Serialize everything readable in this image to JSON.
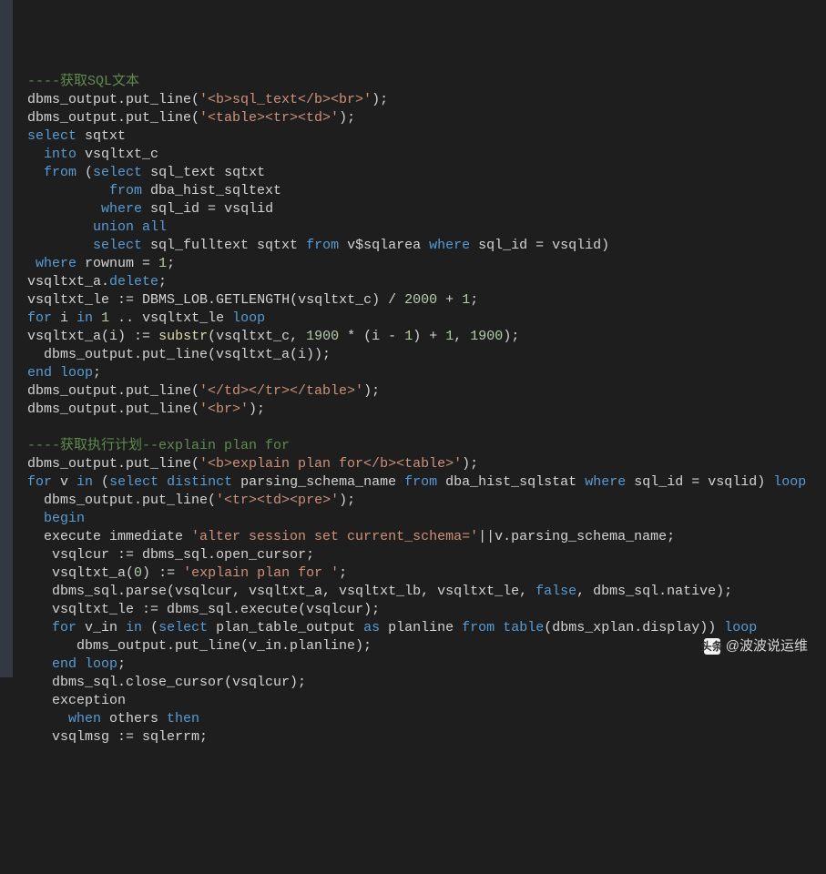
{
  "colors": {
    "bg": "#1e1e1e",
    "gutter": "#333842",
    "text": "#d4d4d4",
    "keyword": "#569cd6",
    "keyword2": "#c586c0",
    "string": "#ce9178",
    "number": "#b5cea8",
    "comment": "#608b4e",
    "function": "#dcdcaa",
    "teal": "#4ec9b0"
  },
  "code": [
    [
      [
        "c-com",
        "----获取SQL文本"
      ]
    ],
    [
      [
        "c-plain",
        "dbms_output.put_line("
      ],
      [
        "c-str",
        "'<b>sql_text</b><br>'"
      ],
      [
        "c-plain",
        ");"
      ]
    ],
    [
      [
        "c-plain",
        "dbms_output.put_line("
      ],
      [
        "c-str",
        "'<table><tr><td>'"
      ],
      [
        "c-plain",
        ");"
      ]
    ],
    [
      [
        "c-kw",
        "select"
      ],
      [
        "c-plain",
        " sqtxt"
      ]
    ],
    [
      [
        "c-plain",
        "  "
      ],
      [
        "c-kw",
        "into"
      ],
      [
        "c-plain",
        " vsqltxt_c"
      ]
    ],
    [
      [
        "c-plain",
        "  "
      ],
      [
        "c-kw",
        "from"
      ],
      [
        "c-plain",
        " ("
      ],
      [
        "c-kw",
        "select"
      ],
      [
        "c-plain",
        " sql_text sqtxt"
      ]
    ],
    [
      [
        "c-plain",
        "          "
      ],
      [
        "c-kw",
        "from"
      ],
      [
        "c-plain",
        " dba_hist_sqltext"
      ]
    ],
    [
      [
        "c-plain",
        "         "
      ],
      [
        "c-kw",
        "where"
      ],
      [
        "c-plain",
        " sql_id "
      ],
      [
        "c-op",
        "="
      ],
      [
        "c-plain",
        " vsqlid"
      ]
    ],
    [
      [
        "c-plain",
        "        "
      ],
      [
        "c-kw",
        "union all"
      ]
    ],
    [
      [
        "c-plain",
        "        "
      ],
      [
        "c-kw",
        "select"
      ],
      [
        "c-plain",
        " sql_fulltext sqtxt "
      ],
      [
        "c-kw",
        "from"
      ],
      [
        "c-plain",
        " v$sqlarea "
      ],
      [
        "c-kw",
        "where"
      ],
      [
        "c-plain",
        " sql_id "
      ],
      [
        "c-op",
        "="
      ],
      [
        "c-plain",
        " vsqlid)"
      ]
    ],
    [
      [
        "c-plain",
        " "
      ],
      [
        "c-kw",
        "where"
      ],
      [
        "c-plain",
        " rownum "
      ],
      [
        "c-op",
        "="
      ],
      [
        "c-plain",
        " "
      ],
      [
        "c-num",
        "1"
      ],
      [
        "c-plain",
        ";"
      ]
    ],
    [
      [
        "c-plain",
        "vsqltxt_a."
      ],
      [
        "c-kw",
        "delete"
      ],
      [
        "c-plain",
        ";"
      ]
    ],
    [
      [
        "c-plain",
        "vsqltxt_le "
      ],
      [
        "c-op",
        ":="
      ],
      [
        "c-plain",
        " DBMS_LOB.GETLENGTH(vsqltxt_c) "
      ],
      [
        "c-op",
        "/"
      ],
      [
        "c-plain",
        " "
      ],
      [
        "c-num",
        "2000"
      ],
      [
        "c-plain",
        " "
      ],
      [
        "c-op",
        "+"
      ],
      [
        "c-plain",
        " "
      ],
      [
        "c-num",
        "1"
      ],
      [
        "c-plain",
        ";"
      ]
    ],
    [
      [
        "c-kw",
        "for"
      ],
      [
        "c-plain",
        " i "
      ],
      [
        "c-kw",
        "in"
      ],
      [
        "c-plain",
        " "
      ],
      [
        "c-num",
        "1"
      ],
      [
        "c-plain",
        " .. vsqltxt_le "
      ],
      [
        "c-kw",
        "loop"
      ]
    ],
    [
      [
        "c-plain",
        "vsqltxt_a(i) "
      ],
      [
        "c-op",
        ":="
      ],
      [
        "c-plain",
        " "
      ],
      [
        "c-fn",
        "substr"
      ],
      [
        "c-plain",
        "(vsqltxt_c, "
      ],
      [
        "c-num",
        "1900"
      ],
      [
        "c-plain",
        " "
      ],
      [
        "c-op",
        "*"
      ],
      [
        "c-plain",
        " (i "
      ],
      [
        "c-op",
        "-"
      ],
      [
        "c-plain",
        " "
      ],
      [
        "c-num",
        "1"
      ],
      [
        "c-plain",
        ") "
      ],
      [
        "c-op",
        "+"
      ],
      [
        "c-plain",
        " "
      ],
      [
        "c-num",
        "1"
      ],
      [
        "c-plain",
        ", "
      ],
      [
        "c-num",
        "1900"
      ],
      [
        "c-plain",
        ");"
      ]
    ],
    [
      [
        "c-plain",
        "  dbms_output.put_line(vsqltxt_a(i));"
      ]
    ],
    [
      [
        "c-kw",
        "end"
      ],
      [
        "c-plain",
        " "
      ],
      [
        "c-kw",
        "loop"
      ],
      [
        "c-plain",
        ";"
      ]
    ],
    [
      [
        "c-plain",
        "dbms_output.put_line("
      ],
      [
        "c-str",
        "'</td></tr></table>'"
      ],
      [
        "c-plain",
        ");"
      ]
    ],
    [
      [
        "c-plain",
        "dbms_output.put_line("
      ],
      [
        "c-str",
        "'<br>'"
      ],
      [
        "c-plain",
        ");"
      ]
    ],
    [
      [
        "c-plain",
        ""
      ]
    ],
    [
      [
        "c-com",
        "----获取执行计划--explain plan for"
      ]
    ],
    [
      [
        "c-plain",
        "dbms_output.put_line("
      ],
      [
        "c-str",
        "'<b>explain plan for</b><table>'"
      ],
      [
        "c-plain",
        ");"
      ]
    ],
    [
      [
        "c-kw",
        "for"
      ],
      [
        "c-plain",
        " v "
      ],
      [
        "c-kw",
        "in"
      ],
      [
        "c-plain",
        " ("
      ],
      [
        "c-kw",
        "select"
      ],
      [
        "c-plain",
        " "
      ],
      [
        "c-kw",
        "distinct"
      ],
      [
        "c-plain",
        " parsing_schema_name "
      ],
      [
        "c-kw",
        "from"
      ],
      [
        "c-plain",
        " dba_hist_sqlstat "
      ],
      [
        "c-kw",
        "where"
      ],
      [
        "c-plain",
        " sql_id "
      ],
      [
        "c-op",
        "="
      ],
      [
        "c-plain",
        " vsqlid) "
      ],
      [
        "c-kw",
        "loop"
      ]
    ],
    [
      [
        "c-plain",
        "  dbms_output.put_line("
      ],
      [
        "c-str",
        "'<tr><td><pre>'"
      ],
      [
        "c-plain",
        ");"
      ]
    ],
    [
      [
        "c-plain",
        "  "
      ],
      [
        "c-kw",
        "begin"
      ]
    ],
    [
      [
        "c-plain",
        "  execute immediate "
      ],
      [
        "c-str",
        "'alter session set current_schema='"
      ],
      [
        "c-op",
        "||"
      ],
      [
        "c-plain",
        "v.parsing_schema_name;"
      ]
    ],
    [
      [
        "c-plain",
        "   vsqlcur "
      ],
      [
        "c-op",
        ":="
      ],
      [
        "c-plain",
        " dbms_sql.open_cursor;"
      ]
    ],
    [
      [
        "c-plain",
        "   vsqltxt_a("
      ],
      [
        "c-num",
        "0"
      ],
      [
        "c-plain",
        ") "
      ],
      [
        "c-op",
        ":="
      ],
      [
        "c-plain",
        " "
      ],
      [
        "c-str",
        "'explain plan for '"
      ],
      [
        "c-plain",
        ";"
      ]
    ],
    [
      [
        "c-plain",
        "   dbms_sql.parse(vsqlcur, vsqltxt_a, vsqltxt_lb, vsqltxt_le, "
      ],
      [
        "c-kw",
        "false"
      ],
      [
        "c-plain",
        ", dbms_sql.native);"
      ]
    ],
    [
      [
        "c-plain",
        "   vsqltxt_le "
      ],
      [
        "c-op",
        ":="
      ],
      [
        "c-plain",
        " dbms_sql.execute(vsqlcur);"
      ]
    ],
    [
      [
        "c-plain",
        "   "
      ],
      [
        "c-kw",
        "for"
      ],
      [
        "c-plain",
        " v_in "
      ],
      [
        "c-kw",
        "in"
      ],
      [
        "c-plain",
        " ("
      ],
      [
        "c-kw",
        "select"
      ],
      [
        "c-plain",
        " plan_table_output "
      ],
      [
        "c-kw",
        "as"
      ],
      [
        "c-plain",
        " planline "
      ],
      [
        "c-kw",
        "from"
      ],
      [
        "c-plain",
        " "
      ],
      [
        "c-kw",
        "table"
      ],
      [
        "c-plain",
        "(dbms_xplan.display)) "
      ],
      [
        "c-kw",
        "loop"
      ]
    ],
    [
      [
        "c-plain",
        "      dbms_output.put_line(v_in.planline);"
      ]
    ],
    [
      [
        "c-plain",
        "   "
      ],
      [
        "c-kw",
        "end"
      ],
      [
        "c-plain",
        " "
      ],
      [
        "c-kw",
        "loop"
      ],
      [
        "c-plain",
        ";"
      ]
    ],
    [
      [
        "c-plain",
        "   dbms_sql.close_cursor(vsqlcur);"
      ]
    ],
    [
      [
        "c-plain",
        "   exception"
      ]
    ],
    [
      [
        "c-plain",
        "     "
      ],
      [
        "c-kw",
        "when"
      ],
      [
        "c-plain",
        " others "
      ],
      [
        "c-kw",
        "then"
      ]
    ],
    [
      [
        "c-plain",
        "   vsqlmsg "
      ],
      [
        "c-op",
        ":="
      ],
      [
        "c-plain",
        " sqlerrm;"
      ]
    ]
  ],
  "watermark": {
    "logo_text": "头条",
    "handle": "@波波说运维"
  }
}
